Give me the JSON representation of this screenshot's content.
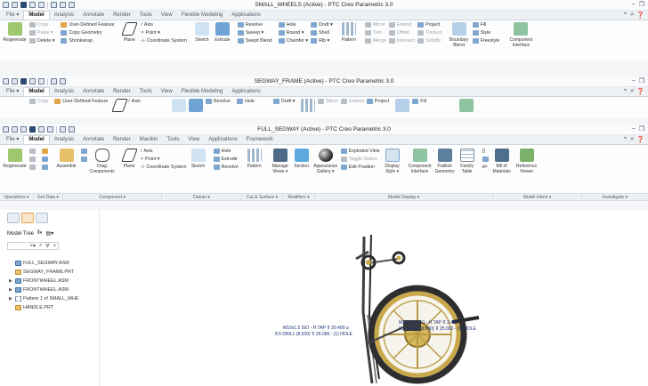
{
  "win1": {
    "title": "SMALL_WHEELS (Active) - PTC Creo Parametric 3.0",
    "tabs": [
      "File ▾",
      "Model",
      "Analysis",
      "Annotate",
      "Render",
      "Tools",
      "View",
      "Flexible Modeling",
      "Applications"
    ],
    "active_tab": "Model",
    "ribbon": {
      "regenerate": "Regenerate",
      "copy": "Copy",
      "paste": "Paste ▾",
      "delete": "Delete ▾",
      "udf": "User-Defined Feature",
      "copy_geometry": "Copy Geometry",
      "shrinkwrap": "Shrinkwrap",
      "plane": "Plane",
      "axis": "Axis",
      "point": "Point ▾",
      "coord_sys": "Coordinate System",
      "sketch": "Sketch",
      "extrude": "Extrude",
      "revolve": "Revolve",
      "sweep": "Sweep ▾",
      "swept_blend": "Swept Blend",
      "hole": "Hole",
      "round": "Round ▾",
      "chamfer": "Chamfer ▾",
      "draft": "Draft ▾",
      "shell": "Shell",
      "rib": "Rib ▾",
      "pattern": "Pattern",
      "mirror": "Mirror",
      "trim": "Trim",
      "merge": "Merge",
      "extend": "Extend",
      "offset": "Offset",
      "intersect": "Intersect",
      "project": "Project",
      "thicken": "Thicken",
      "solidify": "Solidify",
      "boundary_blend": "Boundary Blend",
      "fill": "Fill",
      "style": "Style",
      "freestyle": "Freestyle",
      "component_interface": "Component Interface"
    }
  },
  "win2": {
    "title": "SEGWAY_FRAME (Active) - PTC Creo Parametric 3.0",
    "tabs": [
      "File ▾",
      "Model",
      "Analysis",
      "Annotate",
      "Render",
      "Tools",
      "View",
      "Flexible Modeling",
      "Applications"
    ],
    "active_tab": "Model",
    "ribbon": {
      "copy": "Copy",
      "udf": "User-Defined Feature",
      "axis": "Axis",
      "revolve": "Revolve",
      "hole": "Hole",
      "draft": "Draft ▾",
      "mirror": "Mirror",
      "extend": "Extend",
      "project": "Project",
      "fill": "Fill"
    }
  },
  "win3": {
    "title": "FULL_SEGWAY (Active) - PTC Creo Parametric 3.0",
    "tabs": [
      "File ▾",
      "Model",
      "Analysis",
      "Annotate",
      "Render",
      "Manikin",
      "Tools",
      "View",
      "Applications",
      "Framework"
    ],
    "active_tab": "Model",
    "ribbon": {
      "regenerate": "Regenerate",
      "assemble": "Assemble",
      "drag_components": "Drag Components",
      "plane": "Plane",
      "axis": "Axis",
      "point": "Point ▾",
      "coord_sys": "Coordinate System",
      "sketch": "Sketch",
      "hole": "Hole",
      "extrude": "Extrude",
      "revolve": "Revolve",
      "pattern": "Pattern",
      "manage_views": "Manage Views ▾",
      "section": "Section",
      "appearance_gallery": "Appearance Gallery ▾",
      "exploded_view": "Exploded View",
      "toggle_status": "Toggle Status",
      "edit_position": "Edit Position",
      "display_style": "Display Style ▾",
      "component_interface": "Component Interface",
      "publish_geometry": "Publish Geometry",
      "family_table": "Family Table",
      "bill_of_materials": "Bill of Materials",
      "reference_viewer": "Reference Viewer"
    },
    "groups": [
      "Operations ▾",
      "Get Data ▾",
      "Component ▾",
      "Datum ▾",
      "Cut & Surface ▾",
      "Modifiers ▾",
      "Model Display ▾",
      "Model Intent ▾",
      "Investigate ▾"
    ]
  },
  "tree": {
    "title": "Model Tree",
    "items": [
      {
        "label": "FULL_SEGWAY.ASM",
        "expand": "",
        "type": "asm"
      },
      {
        "label": "SEGWAY_FRAME.PRT",
        "expand": "",
        "type": "prt"
      },
      {
        "label": "FRONTWHEEL.ASM",
        "expand": "▶",
        "type": "asm"
      },
      {
        "label": "FRONTWHEEL.ASM",
        "expand": "▶",
        "type": "asm"
      },
      {
        "label": "Pattern 1 of SMALL_WHE",
        "expand": "▶",
        "type": "pat"
      },
      {
        "label": "HANDLE.PRT",
        "expand": "",
        "type": "prt"
      }
    ]
  },
  "annotations": {
    "a1": "M10x1.5 ISO - H TAP ⊽ 20.400 ⌀",
    "a2": "8.5 DRILL (8.500) ⊽ 25.000 - (1) HOLE",
    "a3": "M10x1.5 ISO - H TAP ⊽ 2.400",
    "a4": "8.5 DRILL (8.800) ⊽ 25.000 - (1) HOLE"
  },
  "colors": {
    "accent": "#3a6ea5",
    "frame": "#4a4a4a",
    "wheel_rim": "#c8a84a",
    "tire": "#2e2e2e",
    "annotation": "#1b2f7a"
  }
}
